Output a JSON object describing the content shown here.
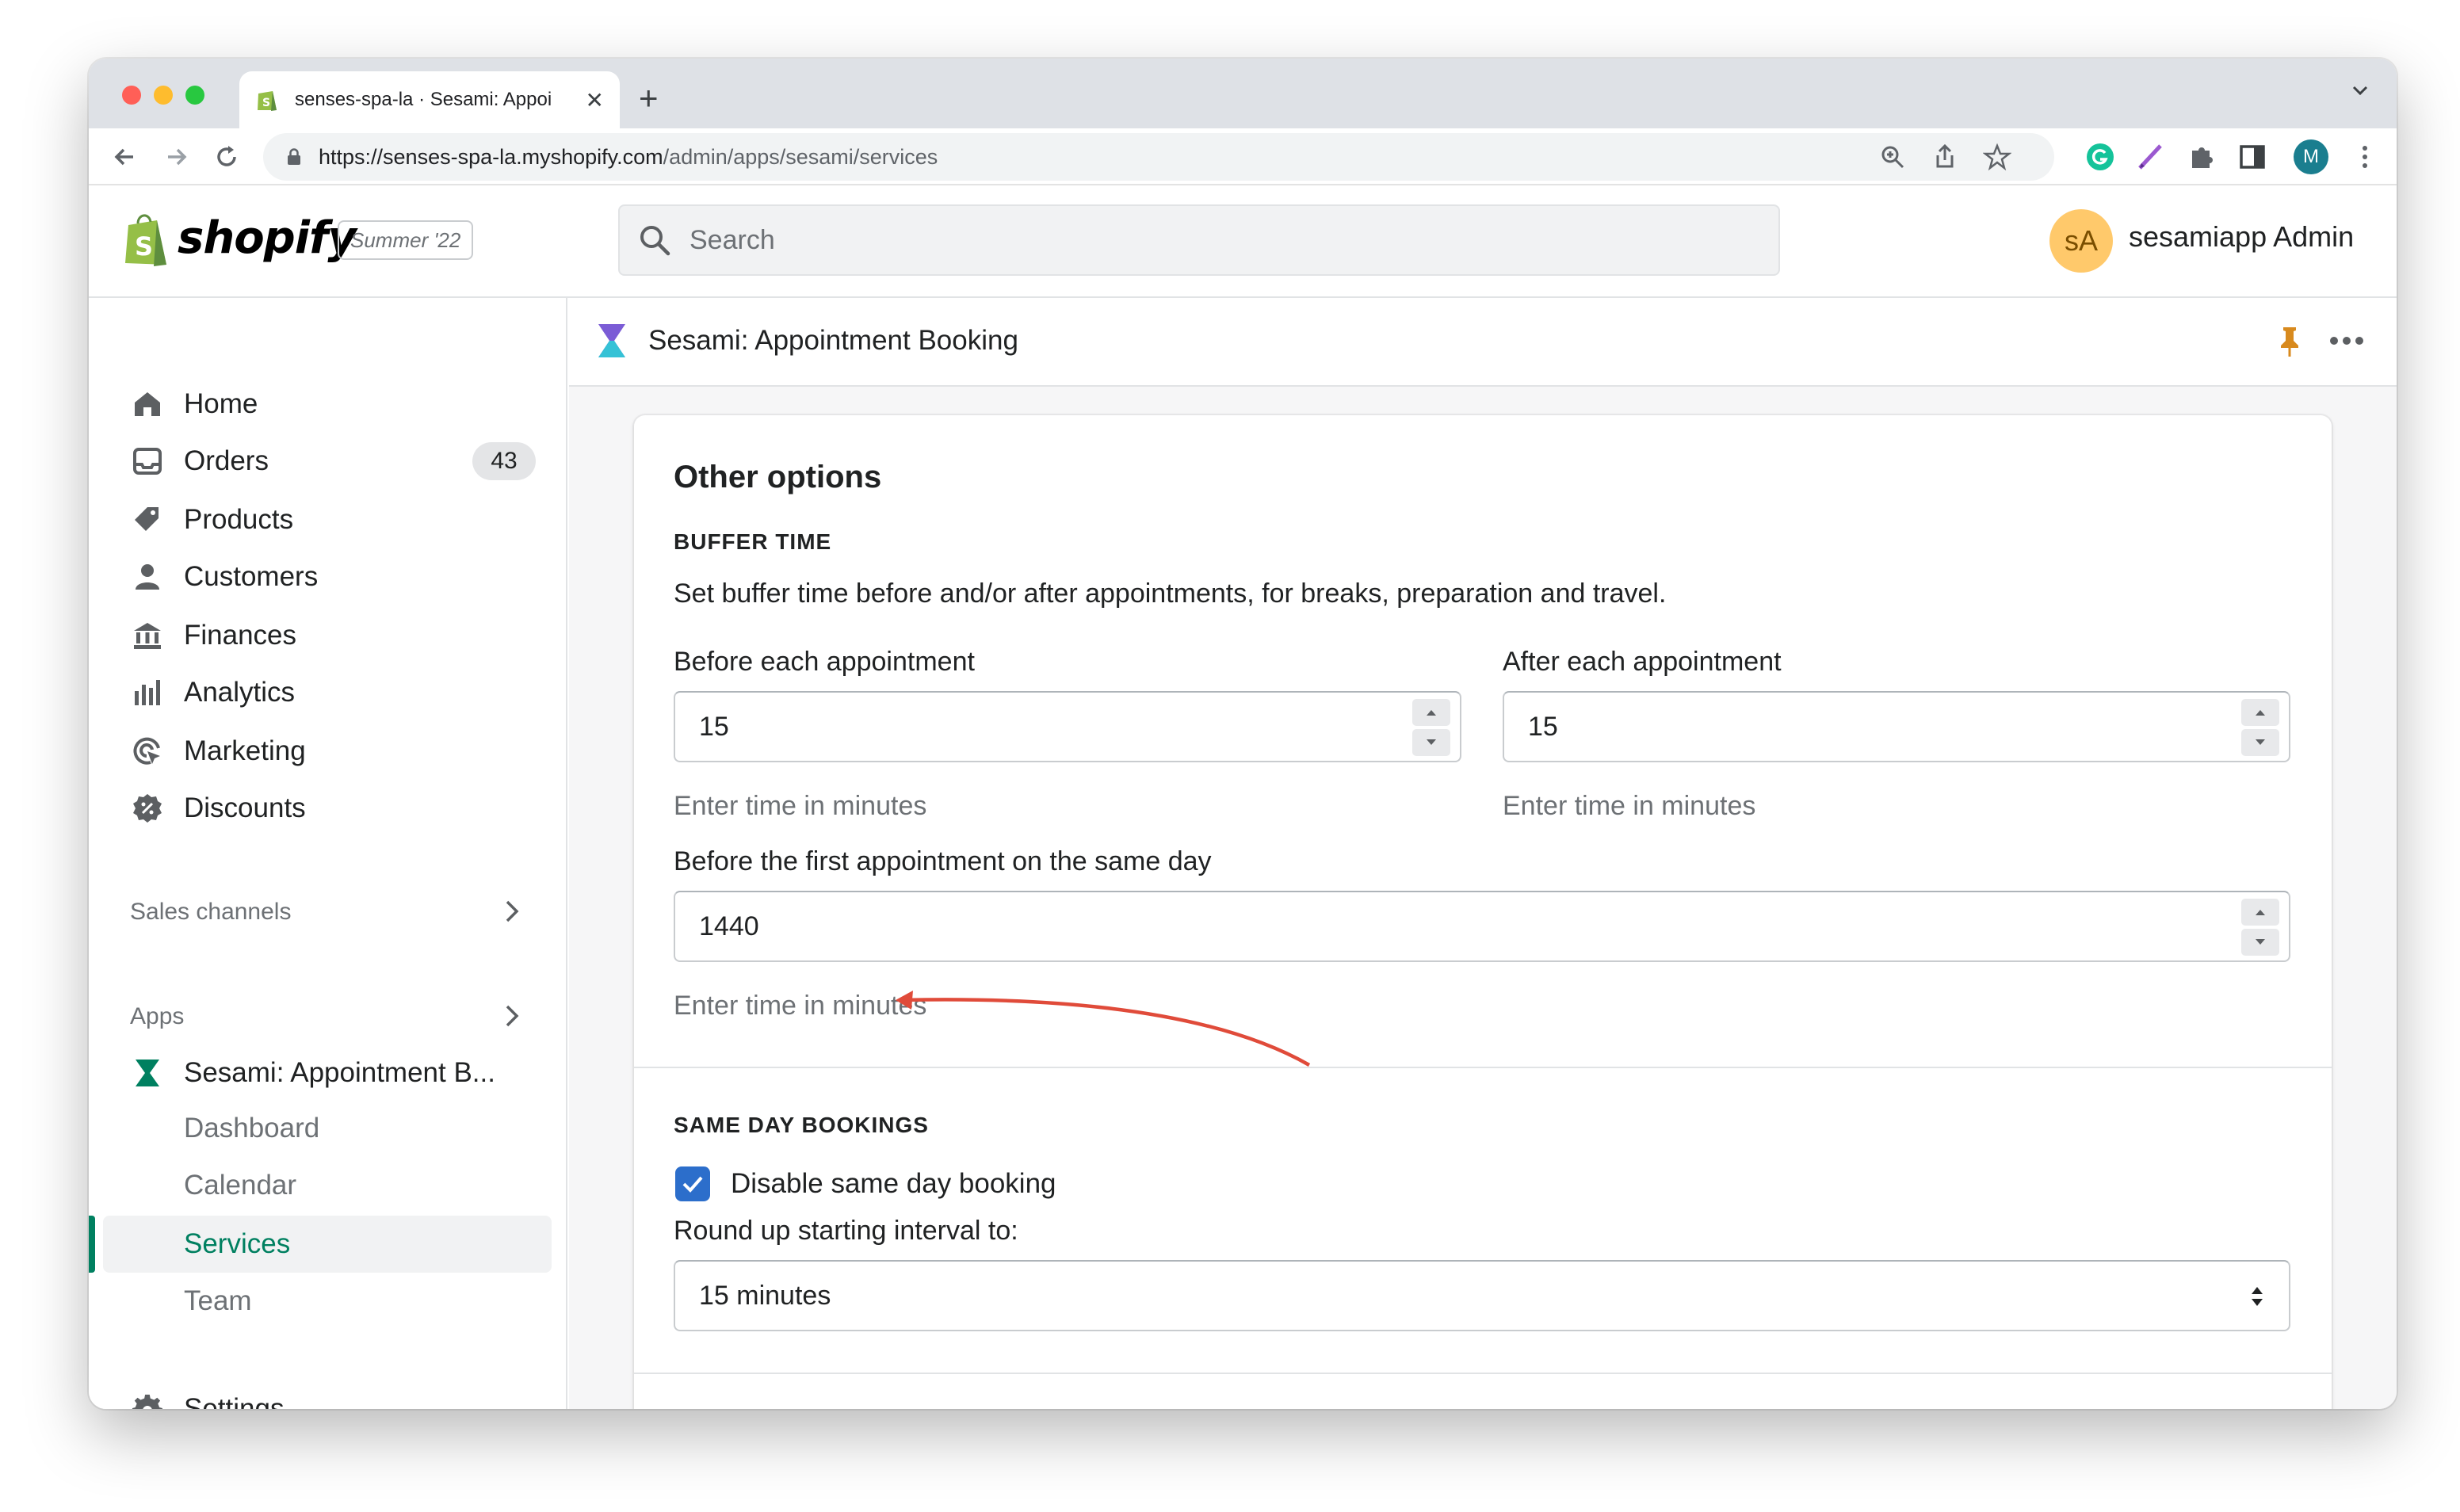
{
  "browser": {
    "tab_title": "senses-spa-la · Sesami: Appoi",
    "url_host": "https://senses-spa-la.myshopify.com",
    "url_path": "/admin/apps/sesami/services",
    "profile_initial": "M"
  },
  "topbar": {
    "logo_text": "shopify",
    "edition_badge": "Summer '22",
    "search_placeholder": "Search",
    "avatar_initials": "sA",
    "admin_name": "sesamiapp Admin"
  },
  "sidebar": {
    "items": [
      {
        "label": "Home",
        "icon": "home-icon"
      },
      {
        "label": "Orders",
        "icon": "orders-icon",
        "badge": "43"
      },
      {
        "label": "Products",
        "icon": "tag-icon"
      },
      {
        "label": "Customers",
        "icon": "person-icon"
      },
      {
        "label": "Finances",
        "icon": "bank-icon"
      },
      {
        "label": "Analytics",
        "icon": "bar-chart-icon"
      },
      {
        "label": "Marketing",
        "icon": "target-icon"
      },
      {
        "label": "Discounts",
        "icon": "discount-icon"
      }
    ],
    "sales_channels_label": "Sales channels",
    "apps_label": "Apps",
    "app_name": "Sesami: Appointment B...",
    "app_subitems": [
      "Dashboard",
      "Calendar",
      "Services",
      "Team"
    ],
    "active_subitem": "Services",
    "settings_label": "Settings"
  },
  "app_header": {
    "title": "Sesami: Appointment Booking"
  },
  "card": {
    "title": "Other options",
    "buffer": {
      "heading": "BUFFER TIME",
      "description": "Set buffer time before and/or after appointments, for breaks, preparation and travel.",
      "before_label": "Before each appointment",
      "before_value": "15",
      "after_label": "After each appointment",
      "after_value": "15",
      "first_label": "Before the first appointment on the same day",
      "first_value": "1440",
      "help": "Enter time in minutes"
    },
    "same_day": {
      "heading": "SAME DAY BOOKINGS",
      "checkbox_label": "Disable same day booking",
      "checked": true,
      "round_label": "Round up starting interval to:",
      "round_value": "15 minutes"
    }
  },
  "colors": {
    "shopify_green": "#008060",
    "checkbox_blue": "#2c6ecb",
    "annotation_arrow": "#e04b3a",
    "avatar_bg": "#ffc96b"
  }
}
